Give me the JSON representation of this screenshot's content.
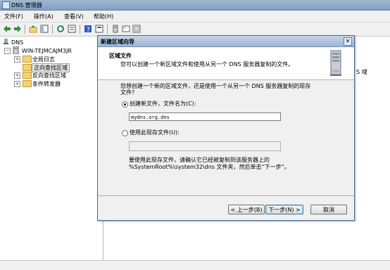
{
  "window": {
    "title": "DNS 管理器"
  },
  "menu": [
    "文件(F)",
    "操作(A)",
    "查看(V)",
    "帮助(H)"
  ],
  "tree": {
    "root": "DNS",
    "server": "WIN-TEJMCAJM3JR",
    "items": [
      "全局日志",
      "正向查找区域",
      "反向查找区域",
      "条件转发器"
    ],
    "selected": "正向查找区域"
  },
  "right_pane": {
    "partial_text": "S 域"
  },
  "dialog": {
    "title": "新建区域向导",
    "close": "✕",
    "header_title": "区域文件",
    "header_desc": "您可以创建一个新区域文件和使用从另一个 DNS 服务器复制的文件。",
    "question_line1": "您想创建一个新的区域文件，还是使用一个从另一个 DNS 服务器复制的现存",
    "question_line2": "文件?",
    "option_new_label": "创建新文件，文件名为(C):",
    "option_new_value": "mydns.org.dns",
    "option_existing_label": "使用此现存文件(U):",
    "option_existing_value": "",
    "note_line1": "要使用此现存文件，请确认它已经被复制到该服务器上的",
    "note_line2": "%SystemRoot%\\system32\\dns 文件夹，然后单击“下一步”。",
    "btn_back": "< 上一步(B)",
    "btn_next": "下一步(N) >",
    "btn_cancel": "取消"
  }
}
